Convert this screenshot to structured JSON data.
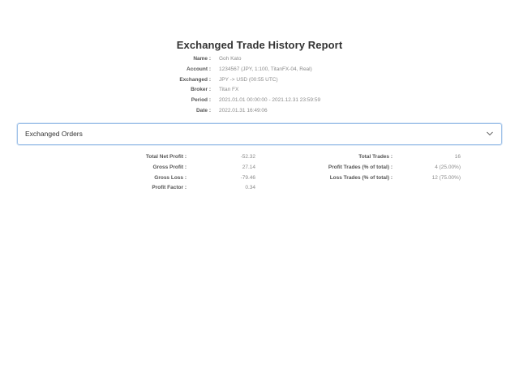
{
  "report": {
    "title": "Exchanged Trade History Report",
    "meta": [
      {
        "label": "Name :",
        "value": "Goh Kato"
      },
      {
        "label": "Account :",
        "value": "1234567 (JPY, 1:100, TitanFX-04, Real)"
      },
      {
        "label": "Exchanged :",
        "value": "JPY -> USD (00:55 UTC)"
      },
      {
        "label": "Broker :",
        "value": "Titan FX"
      },
      {
        "label": "Period :",
        "value": "2021.01.01 00:00:00 - 2021.12.31 23:59:59"
      },
      {
        "label": "Date :",
        "value": "2022.01.31 16:49:06"
      }
    ]
  },
  "orders_dropdown": {
    "label": "Exchanged Orders",
    "chevron_icon": "chevron-down-icon",
    "border_color": "#9ec1e8"
  },
  "summary": {
    "left": [
      {
        "label": "Total Net Profit :",
        "value": "-52.32"
      },
      {
        "label": "Gross Profit :",
        "value": "27.14"
      },
      {
        "label": "Gross Loss :",
        "value": "-79.46"
      },
      {
        "label": "Profit Factor :",
        "value": "0.34"
      }
    ],
    "right": [
      {
        "label": "Total Trades :",
        "value": "16"
      },
      {
        "label": "Profit Trades (% of total) :",
        "value": "4 (25.00%)"
      },
      {
        "label": "Loss Trades (% of total) :",
        "value": "12 (75.00%)"
      }
    ]
  }
}
